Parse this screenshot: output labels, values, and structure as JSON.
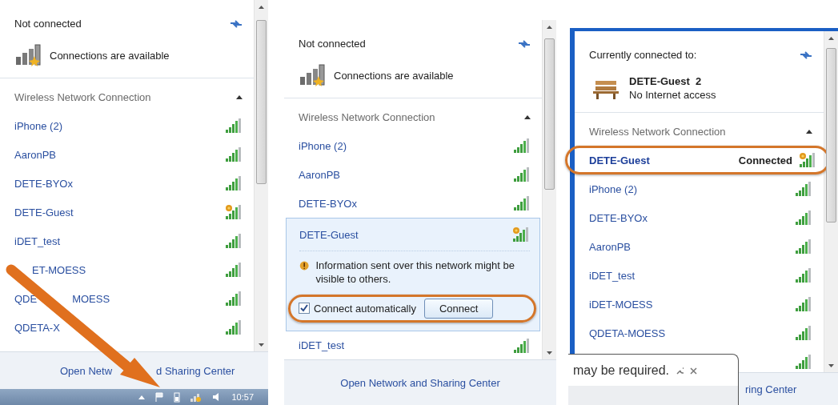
{
  "panels": [
    {
      "kind": "available",
      "status": "Not connected",
      "availability": "Connections are available",
      "section": "Wireless Network Connection",
      "pointer_arrow": true,
      "networks": [
        {
          "kind": "plain",
          "name_parts": [
            "iPhone (2)"
          ],
          "secured": false
        },
        {
          "kind": "plain",
          "name_parts": [
            "AaronPB"
          ],
          "secured": false
        },
        {
          "kind": "plain",
          "name_parts": [
            "DETE-BYOx"
          ],
          "secured": false
        },
        {
          "kind": "plain",
          "name_parts": [
            "DETE-Guest"
          ],
          "secured": true
        },
        {
          "kind": "plain",
          "name_parts": [
            "iDET_test"
          ],
          "secured": false
        },
        {
          "kind": "plain",
          "name_parts": [
            "ET-MOESS"
          ],
          "secured": false
        },
        {
          "kind": "plain",
          "name_parts": [
            "QDE",
            "MOESS"
          ],
          "secured": false
        },
        {
          "kind": "plain",
          "name_parts": [
            "QDETA-X"
          ],
          "secured": false
        }
      ],
      "footer_parts": [
        "Open Netw",
        "d Sharing Center"
      ],
      "taskbar": {
        "time": "10:57"
      }
    },
    {
      "kind": "available",
      "status": "Not connected",
      "availability": "Connections are available",
      "section": "Wireless Network Connection",
      "networks": [
        {
          "kind": "plain",
          "name_parts": [
            "iPhone (2)"
          ],
          "secured": false
        },
        {
          "kind": "plain",
          "name_parts": [
            "AaronPB"
          ],
          "secured": false
        },
        {
          "kind": "plain",
          "name_parts": [
            "DETE-BYOx"
          ],
          "secured": false
        },
        {
          "kind": "expanded",
          "name_parts": [
            "DETE-Guest"
          ],
          "secured": true,
          "warning": "Information sent over this network might be visible to others.",
          "auto_connect": {
            "label": "Connect automatically",
            "checked": true
          },
          "button": "Connect",
          "highlight": true
        },
        {
          "kind": "plain",
          "name_parts": [
            "iDET_test"
          ],
          "secured": false
        }
      ],
      "footer_parts": [
        "Open Network and Sharing Center"
      ]
    },
    {
      "kind": "connected",
      "heading": "Currently connected to:",
      "current_name": "DETE-Guest  2",
      "current_status": "No Internet access",
      "section": "Wireless Network Connection",
      "networks": [
        {
          "kind": "connected",
          "name_parts": [
            "DETE-Guest"
          ],
          "status": "Connected",
          "secured": true,
          "highlight": true
        },
        {
          "kind": "plain",
          "name_parts": [
            "iPhone (2)"
          ],
          "secured": false
        },
        {
          "kind": "plain",
          "name_parts": [
            "DETE-BYOx"
          ],
          "secured": false
        },
        {
          "kind": "plain",
          "name_parts": [
            "AaronPB"
          ],
          "secured": false
        },
        {
          "kind": "plain",
          "name_parts": [
            "iDET_test"
          ],
          "secured": false
        },
        {
          "kind": "plain",
          "name_parts": [
            "iDET-MOESS"
          ],
          "secured": false
        },
        {
          "kind": "plain",
          "name_parts": [
            "QDETA-MOESS"
          ],
          "secured": false
        },
        {
          "kind": "plain",
          "secured": false
        }
      ],
      "footer_parts": [
        "ring Center"
      ],
      "tooltip": {
        "text": "may be required."
      }
    }
  ]
}
